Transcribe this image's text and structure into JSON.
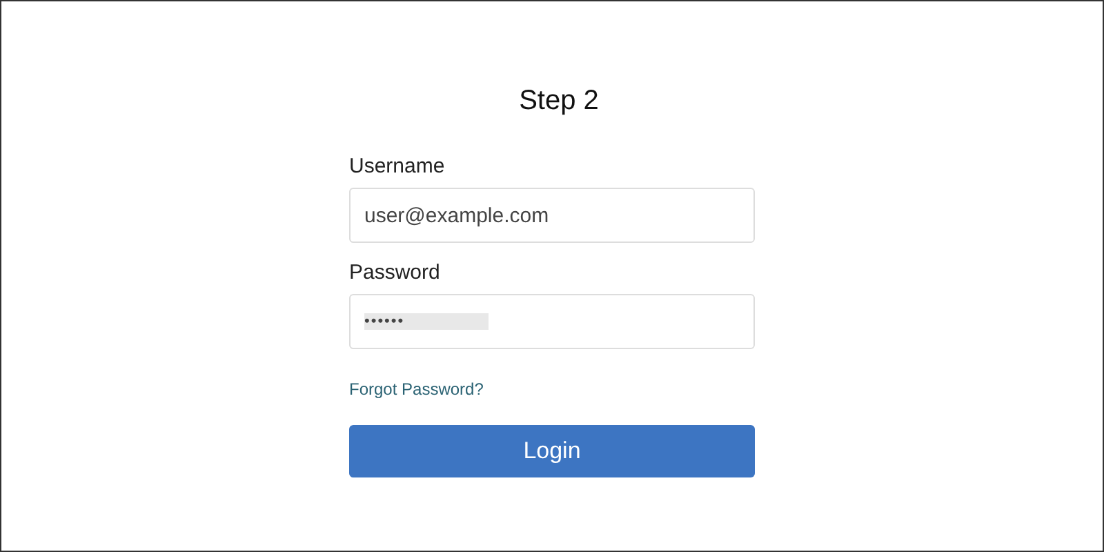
{
  "title": "Step 2",
  "fields": [
    {
      "label": "Username",
      "value": "user@example.com",
      "kind": "text"
    },
    {
      "label": "Password",
      "value": "••••••",
      "kind": "password"
    }
  ],
  "link": "Forgot Password?",
  "button": "Login"
}
